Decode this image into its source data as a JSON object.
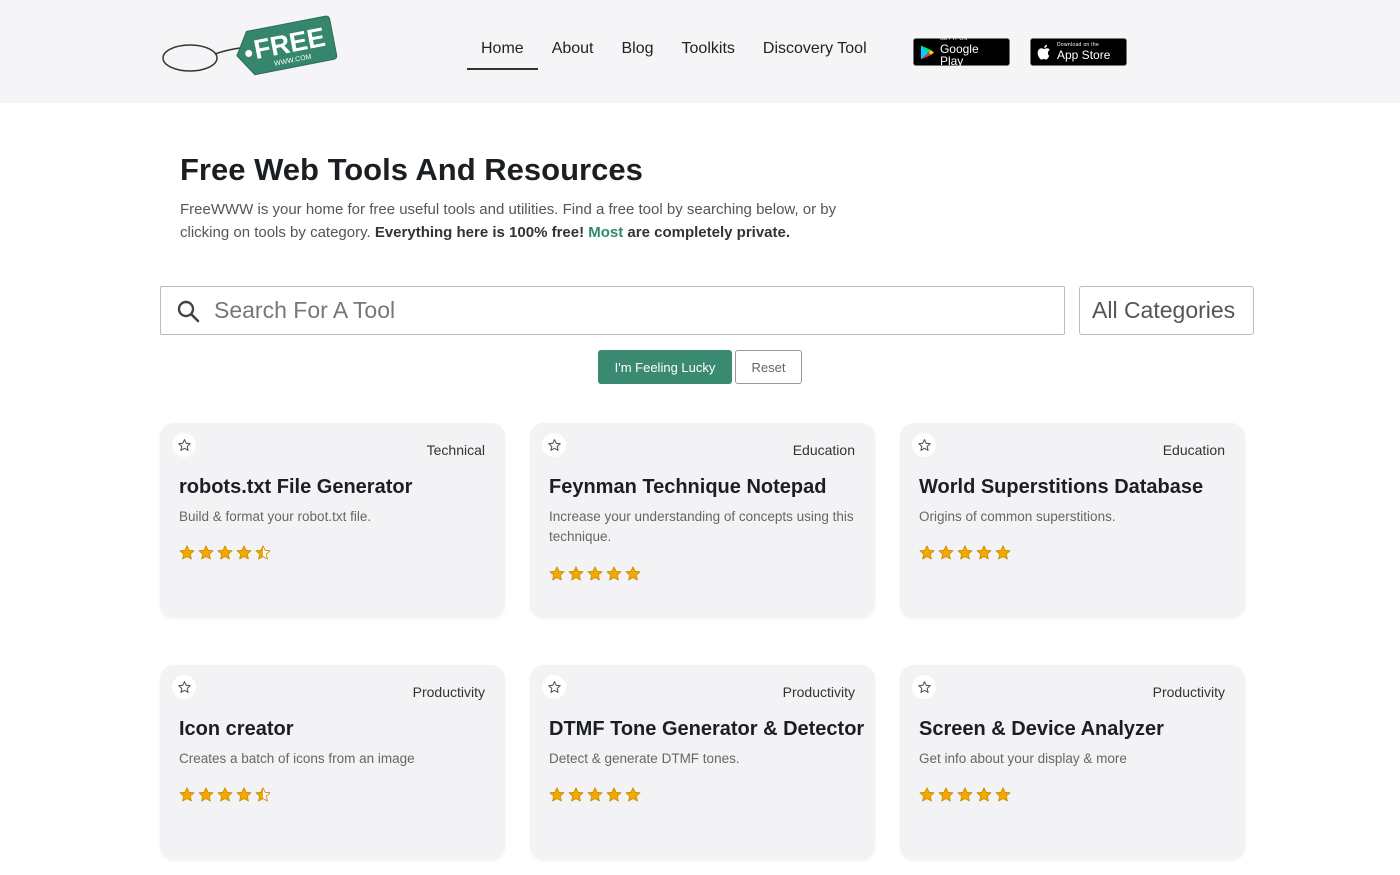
{
  "header": {
    "logo_text": "FREE",
    "logo_subtext": "WWW.COM",
    "nav": [
      "Home",
      "About",
      "Blog",
      "Toolkits",
      "Discovery Tool"
    ],
    "active_nav": "Home",
    "google_play": {
      "small": "GET IT ON",
      "big": "Google Play"
    },
    "app_store": {
      "small": "Download on the",
      "big": "App Store"
    }
  },
  "hero": {
    "title": "Free Web Tools And Resources",
    "desc_plain": "FreeWWW is your home for free useful tools and utilities. Find a free tool by searching below, or by clicking on tools by category. ",
    "desc_bold": "Everything here is 100% free! ",
    "desc_green": "Most",
    "desc_bold_end": " are completely private."
  },
  "search": {
    "placeholder": "Search For A Tool",
    "category_value": "All Categories"
  },
  "buttons": {
    "lucky": "I'm Feeling Lucky",
    "reset": "Reset"
  },
  "cards": [
    {
      "category": "Technical",
      "title": "robots.txt File Generator",
      "desc": "Build & format your robot.txt file.",
      "rating": 4.5
    },
    {
      "category": "Education",
      "title": "Feynman Technique Notepad",
      "desc": "Increase your understanding of concepts using this technique.",
      "rating": 5
    },
    {
      "category": "Education",
      "title": "World Superstitions Database",
      "desc": "Origins of common superstitions.",
      "rating": 5
    },
    {
      "category": "Productivity",
      "title": "Icon creator",
      "desc": "Creates a batch of icons from an image",
      "rating": 4.5
    },
    {
      "category": "Productivity",
      "title": "DTMF Tone Generator & Detector",
      "desc": "Detect & generate DTMF tones.",
      "rating": 5
    },
    {
      "category": "Productivity",
      "title": "Screen & Device Analyzer",
      "desc": "Get info about your display & more",
      "rating": 5
    }
  ],
  "colors": {
    "accent": "#3a8a72",
    "star": "#f2a900",
    "card_bg": "#f3f3f6"
  }
}
